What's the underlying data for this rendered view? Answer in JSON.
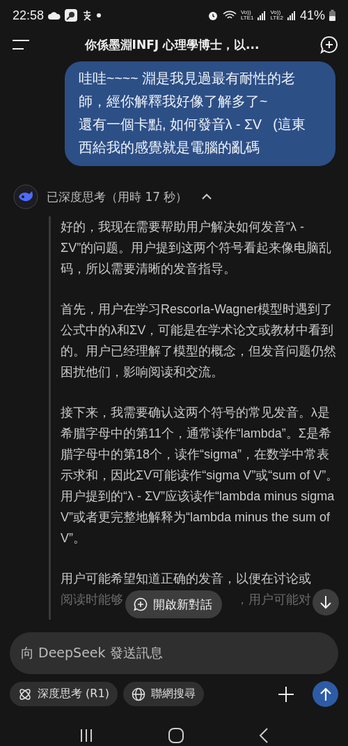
{
  "status_bar": {
    "time": "22:58",
    "network_labels": [
      {
        "top": "Vo))",
        "bottom": "LTE1"
      },
      {
        "top": "Vo))",
        "bottom": "LTE2"
      }
    ],
    "battery": "41%"
  },
  "header": {
    "title": "你係墨淵INFJ 心理學博士，以..."
  },
  "user_message": "哇哇~~~~ 淵是我見過最有耐性的老師，經你解釋我好像了解多了~\n還有一個卡點, 如何發音λ - ΣV   (這東西給我的感覺就是電腦的亂碼",
  "thinking": {
    "label": "已深度思考（用時 17 秒）",
    "expanded": true,
    "paragraphs": [
      "好的，我现在需要帮助用户解决如何发音“λ - ΣV”的问题。用户提到这两个符号看起来像电脑乱码，所以需要清晰的发音指导。",
      "首先，用户在学习Rescorla-Wagner模型时遇到了公式中的λ和ΣV，可能是在学术论文或教材中看到的。用户已经理解了模型的概念，但发音问题仍然困扰他们，影响阅读和交流。",
      "接下来，我需要确认这两个符号的常见发音。λ是希腊字母中的第11个，通常读作“lambda”。Σ是希腊字母中的第18个，读作“sigma”，在数学中常表示求和，因此ΣV可能读作“sigma V”或“sum of V”。用户提到的“λ - ΣV”应该读作“lambda minus sigma V”或者更完整地解释为“lambda minus the sum of V”。",
      "用户可能希望知道正确的发音，以便在讨论或"
    ],
    "faded_left": "阅读时能够",
    "faded_right": "，用户可能对"
  },
  "new_chat_button": "開啟新對話",
  "composer": {
    "placeholder": "向 DeepSeek 發送訊息",
    "chips": [
      {
        "label": "深度思考 (R1)",
        "kind": "think",
        "selected": false
      },
      {
        "label": "聯網搜尋",
        "kind": "web",
        "selected": false
      }
    ]
  }
}
